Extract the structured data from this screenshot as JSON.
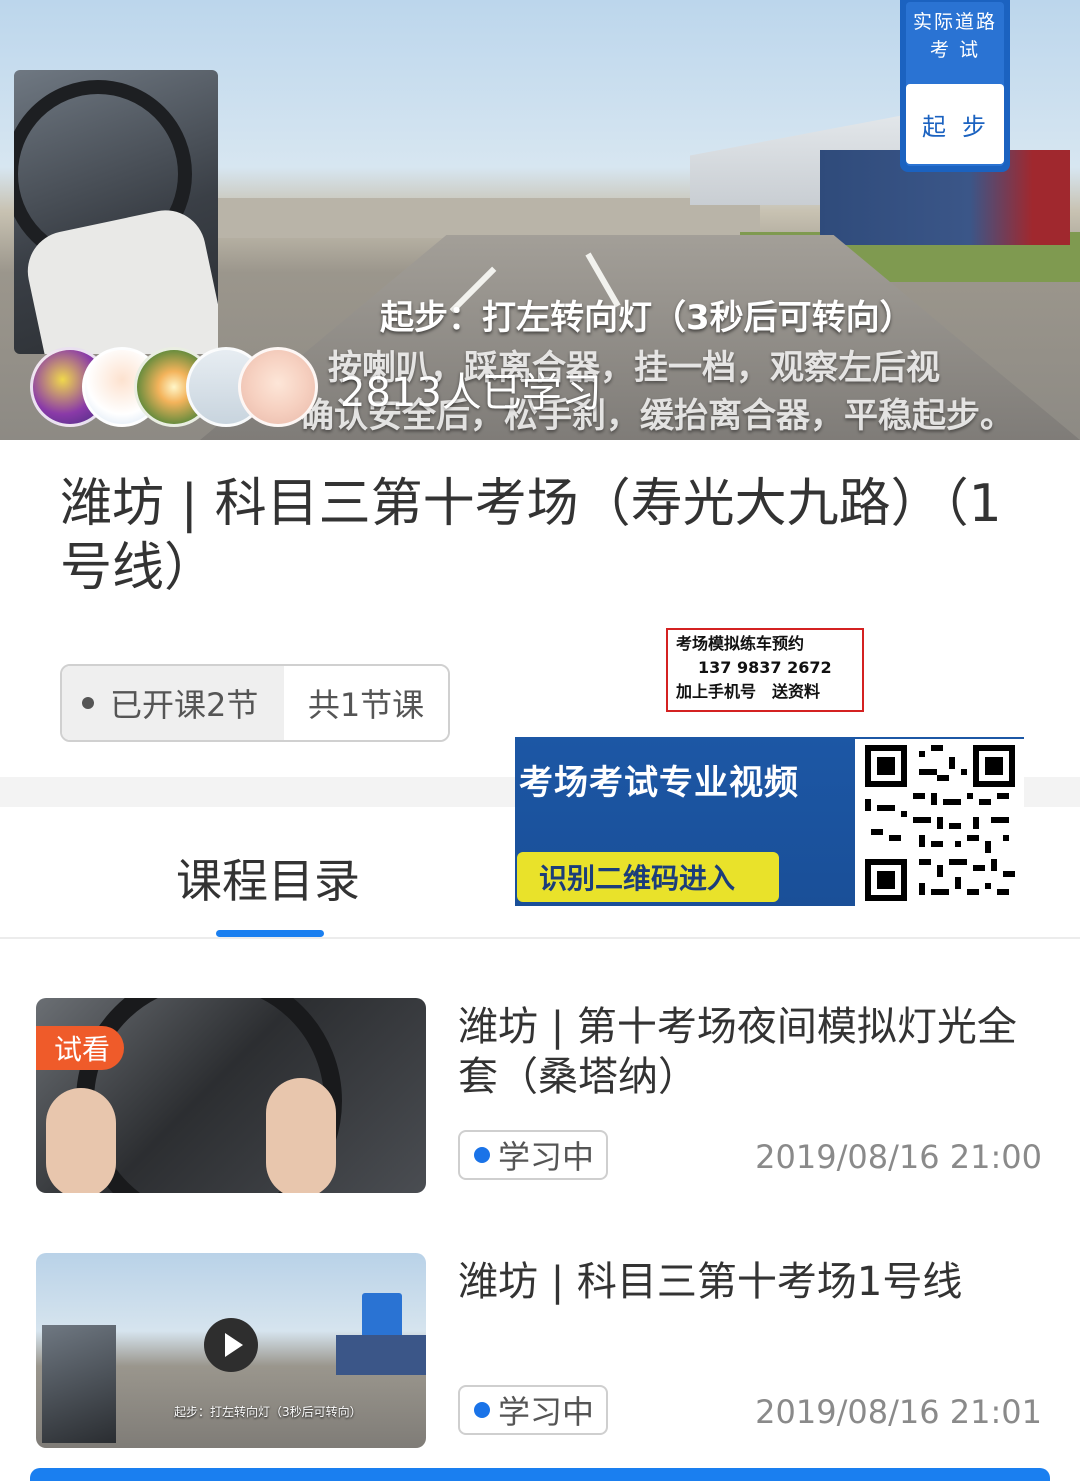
{
  "hero": {
    "sign_top_line1": "实际道路",
    "sign_top_line2": "考 试",
    "sign_bottom": "起步",
    "subtitle_line1": "起步：打左转向灯（3秒后可转向）",
    "subtitle_line2": "按喇叭，踩离合器，挂一档，观察左后视",
    "subtitle_line3": "确认安全后，松手刹，缓抬离合器，平稳起步。",
    "learners": "2813人已学习"
  },
  "course": {
    "title": "潍坊 | 科目三第十考场（寿光大九路）（1号线）",
    "opened": "已开课2节",
    "total": "共1节课"
  },
  "promo": {
    "line1": "考场模拟练车预约",
    "line2": "137 9837 2672",
    "line3": "加上手机号　送资料",
    "banner_headline": "考场考试专业视频",
    "banner_button": "识别二维码进入"
  },
  "tabs": {
    "catalog": "课程目录"
  },
  "lessons": [
    {
      "badge": "试看",
      "title": "潍坊 | 第十考场夜间模拟灯光全套（桑塔纳）",
      "status": "学习中",
      "time": "2019/08/16 21:00"
    },
    {
      "title": "潍坊 | 科目三第十考场1号线",
      "status": "学习中",
      "time": "2019/08/16 21:01",
      "thumb_caption": "起步：打左转向灯（3秒后可转向）"
    }
  ],
  "colors": {
    "accent": "#1a7ff0",
    "badge": "#ef5b2a",
    "promo_border": "#d42121",
    "banner": "#1c57a5",
    "banner_button": "#e9e22a"
  },
  "icons": [
    "play-icon",
    "dot-icon",
    "qr-code-icon"
  ]
}
